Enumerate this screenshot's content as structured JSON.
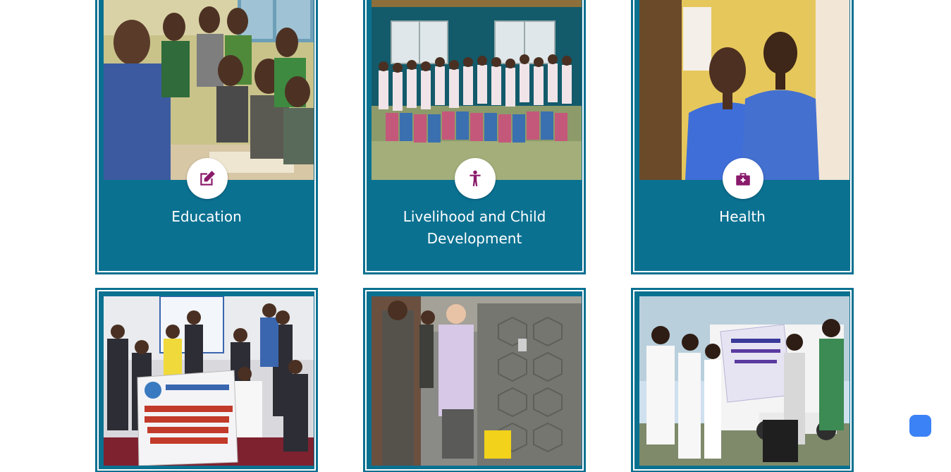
{
  "colors": {
    "card_background": "#0b7191",
    "icon_color": "#8a1a6b",
    "float_button": "#3b82f6"
  },
  "cards": [
    {
      "title": "Education",
      "icon": "edit-icon"
    },
    {
      "title": "Livelihood and Child Development",
      "icon": "child-icon"
    },
    {
      "title": "Health",
      "icon": "medkit-icon"
    },
    {
      "title": "",
      "icon": ""
    },
    {
      "title": "",
      "icon": ""
    },
    {
      "title": "",
      "icon": ""
    }
  ],
  "photo_banners": {
    "training_banner": "IVASE CHILDREN'S AID AND TRAINING (IVCAT) TRAINING ON CHANGE MANAGEMENT AND RESOURCE MOBILIZATION FOR KINDERPOSTEGEZES PARTNERS",
    "peace_banner": "Participation in Decision for Post-Conflict Recovery and Sustainable Peace"
  }
}
